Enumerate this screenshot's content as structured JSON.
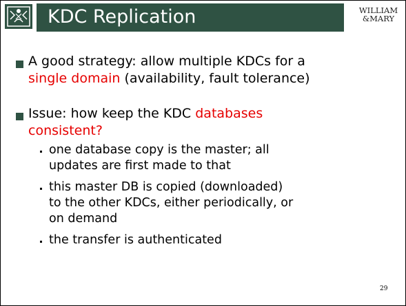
{
  "header": {
    "title": "KDC Replication",
    "logo_icon": "crest-icon",
    "wordmark": [
      "WILLIAM",
      "&MARY"
    ]
  },
  "bullets": [
    {
      "lines": [
        [
          {
            "t": "A good strategy: allow multiple KDCs for a",
            "red": false
          }
        ],
        [
          {
            "t": "single domain",
            "red": true
          },
          {
            "t": " (availability, fault tolerance)",
            "red": false
          }
        ]
      ]
    },
    {
      "lines": [
        [
          {
            "t": "Issue: how keep the KDC ",
            "red": false
          },
          {
            "t": "databases",
            "red": true
          }
        ],
        [
          {
            "t": "consistent?",
            "red": true
          }
        ]
      ],
      "sub": [
        [
          "one database copy is the master; all",
          "updates are first made to that"
        ],
        [
          "this master DB is copied (downloaded)",
          "to the other KDCs, either periodically, or",
          "on demand"
        ],
        [
          "the transfer is authenticated"
        ]
      ]
    }
  ],
  "page_number": "29",
  "colors": {
    "accent": "#2f5243",
    "highlight": "#e60000"
  }
}
